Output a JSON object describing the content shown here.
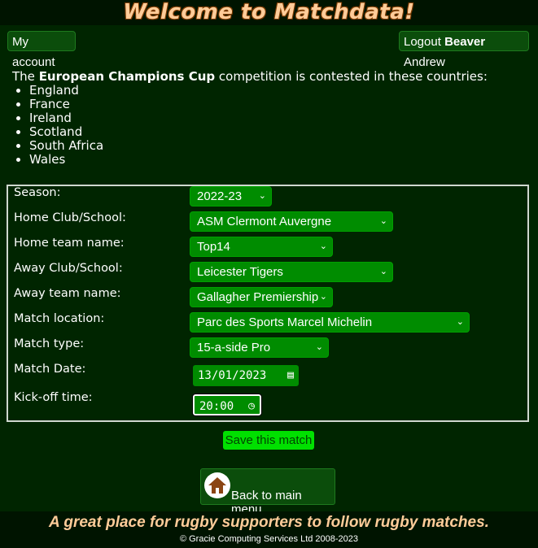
{
  "header": {
    "title": "Welcome to Matchdata!"
  },
  "nav": {
    "my_account": "My account",
    "logout_prefix": "Logout",
    "user_last": "Beaver",
    "user_first": "Andrew"
  },
  "intro": {
    "prefix": "The",
    "competition": "European Champions Cup",
    "suffix": "competition is contested in these countries:",
    "countries": [
      "England",
      "France",
      "Ireland",
      "Scotland",
      "South Africa",
      "Wales"
    ]
  },
  "form": {
    "season": {
      "label": "Season:",
      "value": "2022-23"
    },
    "home_club": {
      "label": "Home Club/School:",
      "value": "ASM Clermont Auvergne"
    },
    "home_team": {
      "label": "Home team name:",
      "value": "Top14"
    },
    "away_club": {
      "label": "Away Club/School:",
      "value": "Leicester Tigers"
    },
    "away_team": {
      "label": "Away team name:",
      "value": "Gallagher Premiership"
    },
    "location": {
      "label": "Match location:",
      "value": "Parc des Sports Marcel Michelin"
    },
    "match_type": {
      "label": "Match type:",
      "value": "15-a-side Pro"
    },
    "match_date": {
      "label": "Match Date:",
      "value": "13/01/2023"
    },
    "kickoff": {
      "label": "Kick-off time:",
      "value": "20:00"
    }
  },
  "actions": {
    "save": "Save this match",
    "back": "Back to main menu"
  },
  "footer": {
    "tagline": "A great place for rugby supporters to follow rugby matches.",
    "copyright": "© Gracie Computing Services Ltd 2008-2023"
  },
  "colors": {
    "background": "#002500",
    "header_bg": "#001400",
    "title": "#ffcc99",
    "select_bg": "#008c00",
    "save_bg": "#00e000"
  }
}
